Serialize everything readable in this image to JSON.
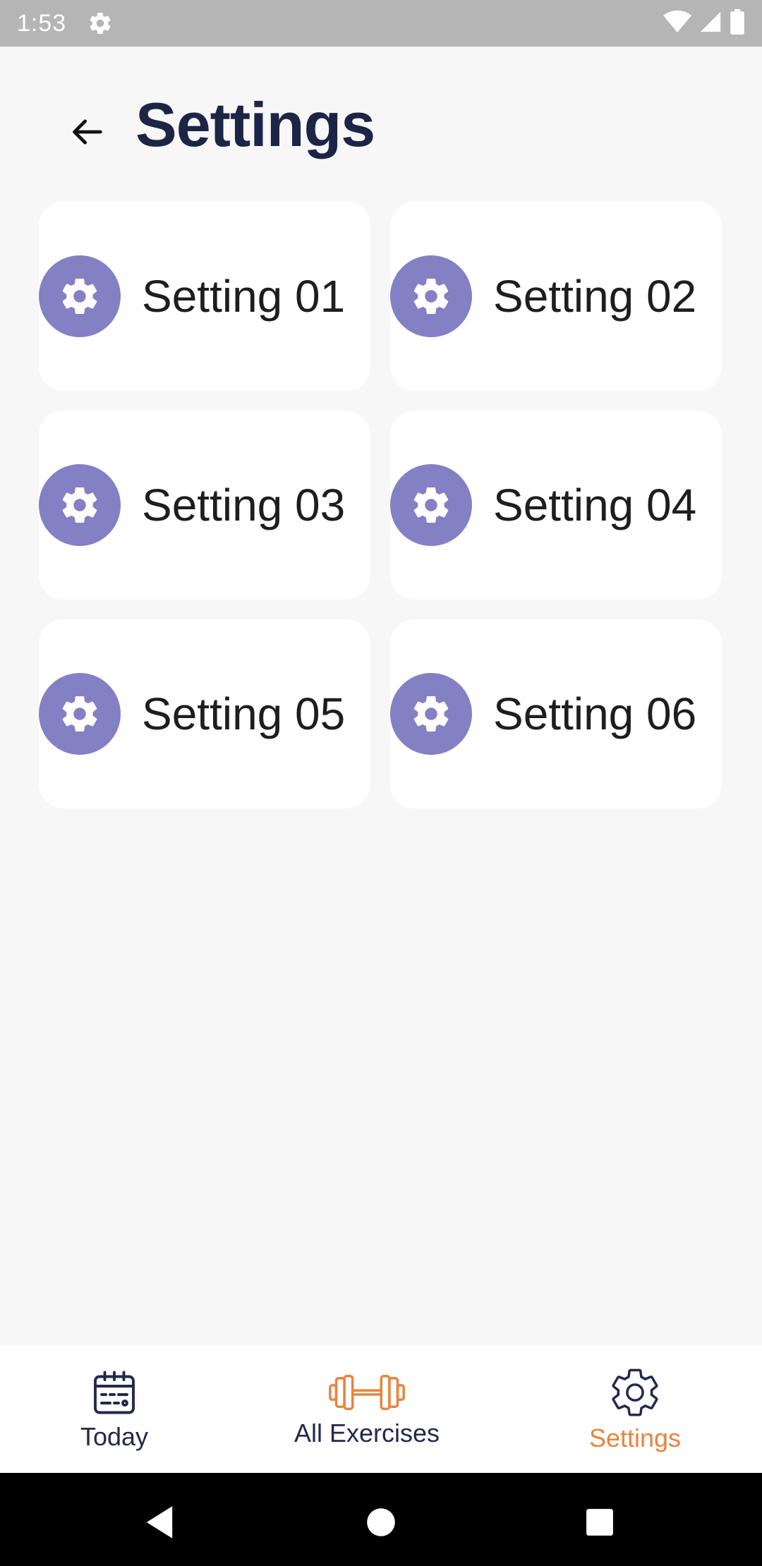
{
  "status_bar": {
    "time": "1:53"
  },
  "header": {
    "title": "Settings"
  },
  "settings_items": [
    {
      "label": "Setting 01"
    },
    {
      "label": "Setting 02"
    },
    {
      "label": "Setting 03"
    },
    {
      "label": "Setting 04"
    },
    {
      "label": "Setting 05"
    },
    {
      "label": "Setting 06"
    }
  ],
  "bottom_nav": {
    "items": [
      {
        "label": "Today",
        "icon": "calendar-icon"
      },
      {
        "label": "All Exercises",
        "icon": "dumbbell-icon"
      },
      {
        "label": "Settings",
        "icon": "gear-icon",
        "active": true
      }
    ]
  },
  "colors": {
    "accent": "#e8843e",
    "icon_circle": "#8480c4",
    "title": "#1c2545",
    "background": "#f7f7f7"
  }
}
